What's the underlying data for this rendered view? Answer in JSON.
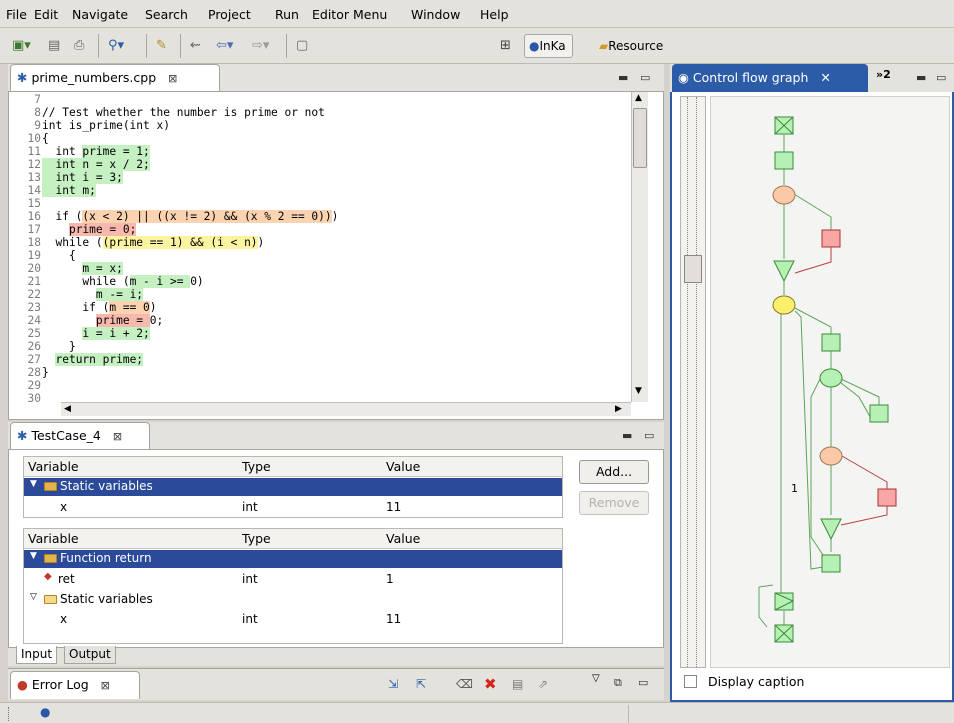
{
  "menu": [
    "File",
    "Edit",
    "Navigate",
    "Search",
    "Project",
    "Run",
    "Editor Menu",
    "Window",
    "Help"
  ],
  "toolbar": {
    "perspectives": [
      {
        "label": "InKa",
        "active": true
      },
      {
        "label": "Resource",
        "active": false
      }
    ]
  },
  "editor": {
    "tab_label": "prime_numbers.cpp",
    "close_glyph": "⊠",
    "lines": [
      {
        "n": "7",
        "parts": [
          {
            "t": "",
            "h": ""
          }
        ]
      },
      {
        "n": "8",
        "parts": [
          {
            "t": "// Test whether the number is prime or not",
            "h": ""
          }
        ]
      },
      {
        "n": "9",
        "parts": [
          {
            "t": "int is_prime(int x)",
            "h": ""
          }
        ]
      },
      {
        "n": "10",
        "parts": [
          {
            "t": "{",
            "h": ""
          }
        ]
      },
      {
        "n": "11",
        "parts": [
          {
            "t": "  int ",
            "h": ""
          },
          {
            "t": "prime = 1;",
            "h": "hg"
          }
        ]
      },
      {
        "n": "12",
        "parts": [
          {
            "t": "  int n = x / 2;",
            "h": "hg"
          }
        ]
      },
      {
        "n": "13",
        "parts": [
          {
            "t": "  int i = 3;",
            "h": "hg"
          }
        ]
      },
      {
        "n": "14",
        "parts": [
          {
            "t": "  int m;",
            "h": "hg"
          }
        ]
      },
      {
        "n": "15",
        "parts": [
          {
            "t": "",
            "h": ""
          }
        ]
      },
      {
        "n": "16",
        "parts": [
          {
            "t": "  if (",
            "h": ""
          },
          {
            "t": "(x < 2) || ((x != 2) && (x % 2 == 0))",
            "h": "ho"
          },
          {
            "t": ")",
            "h": ""
          }
        ]
      },
      {
        "n": "17",
        "parts": [
          {
            "t": "    ",
            "h": ""
          },
          {
            "t": "prime = 0;",
            "h": "hr"
          }
        ]
      },
      {
        "n": "18",
        "parts": [
          {
            "t": "  while (",
            "h": ""
          },
          {
            "t": "(prime == 1) && (i < n)",
            "h": "hy"
          },
          {
            "t": ")",
            "h": ""
          }
        ]
      },
      {
        "n": "19",
        "parts": [
          {
            "t": "    {",
            "h": ""
          }
        ]
      },
      {
        "n": "20",
        "parts": [
          {
            "t": "      ",
            "h": ""
          },
          {
            "t": "m = x;",
            "h": "hg"
          }
        ]
      },
      {
        "n": "21",
        "parts": [
          {
            "t": "      while (",
            "h": ""
          },
          {
            "t": "m - i >= ",
            "h": "hg"
          },
          {
            "t": "0)",
            "h": ""
          }
        ]
      },
      {
        "n": "22",
        "parts": [
          {
            "t": "        ",
            "h": ""
          },
          {
            "t": "m -= i;",
            "h": "hg"
          }
        ]
      },
      {
        "n": "23",
        "parts": [
          {
            "t": "      if (",
            "h": ""
          },
          {
            "t": "m == 0",
            "h": "ho"
          },
          {
            "t": ")",
            "h": ""
          }
        ]
      },
      {
        "n": "24",
        "parts": [
          {
            "t": "        ",
            "h": ""
          },
          {
            "t": "prime = ",
            "h": "hr"
          },
          {
            "t": "0;",
            "h": ""
          }
        ]
      },
      {
        "n": "25",
        "parts": [
          {
            "t": "      ",
            "h": ""
          },
          {
            "t": "i = i + 2;",
            "h": "hg"
          }
        ]
      },
      {
        "n": "26",
        "parts": [
          {
            "t": "    }",
            "h": ""
          }
        ]
      },
      {
        "n": "27",
        "parts": [
          {
            "t": "  ",
            "h": ""
          },
          {
            "t": "return prime;",
            "h": "hg"
          }
        ]
      },
      {
        "n": "28",
        "parts": [
          {
            "t": "}",
            "h": ""
          }
        ]
      },
      {
        "n": "29",
        "parts": [
          {
            "t": "",
            "h": ""
          }
        ]
      },
      {
        "n": "30",
        "parts": [
          {
            "t": "",
            "h": ""
          }
        ]
      }
    ]
  },
  "testcase": {
    "tab_label": "TestCase_4",
    "columns": [
      "Variable",
      "Type",
      "Value"
    ],
    "input_table": {
      "group": "Static variables",
      "rows": [
        {
          "variable": "x",
          "type": "int",
          "value": "11"
        }
      ]
    },
    "output_table": {
      "groups": [
        {
          "label": "Function return",
          "rows": [
            {
              "variable": "ret",
              "type": "int",
              "value": "1"
            }
          ]
        },
        {
          "label": "Static variables",
          "rows": [
            {
              "variable": "x",
              "type": "int",
              "value": "11"
            }
          ]
        }
      ]
    },
    "buttons": {
      "add": "Add...",
      "remove": "Remove"
    },
    "bottom_tabs": [
      "Input",
      "Output"
    ]
  },
  "errorlog": {
    "tab_label": "Error Log"
  },
  "cfg": {
    "tab_label": "Control flow graph",
    "overflow_label": "»2",
    "checkbox_label": "Display caption",
    "checked": false,
    "marker_label": "1"
  }
}
